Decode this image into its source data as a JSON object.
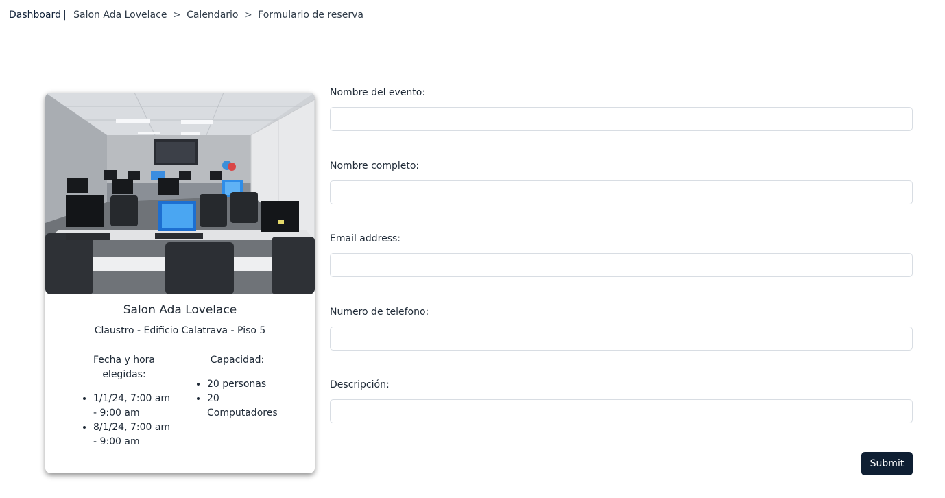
{
  "breadcrumb": {
    "dashboard": "Dashboard",
    "separator": "|",
    "arrow": ">",
    "items": [
      "Salon Ada Lovelace",
      "Calendario",
      "Formulario de reserva"
    ]
  },
  "room": {
    "image_alt": "Computer lab with desks and monitors",
    "name": "Salon Ada Lovelace",
    "location": "Claustro - Edificio Calatrava - Piso 5",
    "dates_heading": "Fecha y hora elegidas:",
    "dates": [
      "1/1/24, 7:00 am - 9:00 am",
      "8/1/24, 7:00 am - 9:00 am"
    ],
    "capacity_heading": "Capacidad:",
    "capacity": [
      "20 personas",
      "20 Computadores"
    ]
  },
  "form": {
    "event_name_label": "Nombre del evento:",
    "full_name_label": "Nombre completo:",
    "email_label": "Email address:",
    "phone_label": "Numero de telefono:",
    "description_label": "Descripción:",
    "event_name_value": "",
    "full_name_value": "",
    "email_value": "",
    "phone_value": "",
    "description_value": "",
    "submit_label": "Submit"
  },
  "colors": {
    "submit_bg": "#0f1f33",
    "text": "#1f2a37",
    "input_border": "#d8dde3"
  }
}
